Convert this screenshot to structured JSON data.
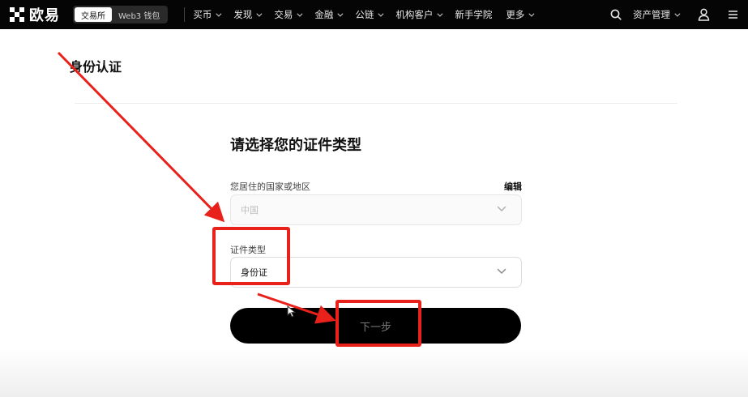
{
  "header": {
    "brand": "欧易",
    "segments": [
      "交易所",
      "Web3 钱包"
    ],
    "nav": [
      {
        "label": "买币",
        "has_menu": true
      },
      {
        "label": "发现",
        "has_menu": true
      },
      {
        "label": "交易",
        "has_menu": true
      },
      {
        "label": "金融",
        "has_menu": true
      },
      {
        "label": "公链",
        "has_menu": true
      },
      {
        "label": "机构客户",
        "has_menu": true
      },
      {
        "label": "新手学院",
        "has_menu": false
      },
      {
        "label": "更多",
        "has_menu": true
      }
    ],
    "asset_management": "资产管理",
    "icons": [
      "search-icon",
      "user-icon",
      "menu-icon"
    ]
  },
  "page": {
    "title": "身份认证"
  },
  "form": {
    "heading": "请选择您的证件类型",
    "region_label": "您居住的国家或地区",
    "edit": "编辑",
    "region_value": "中国",
    "id_type_label": "证件类型",
    "id_type_value": "身份证",
    "next_button": "下一步"
  },
  "colors": {
    "annotation": "#e8211a",
    "topbar": "#050505",
    "button": "#000000"
  }
}
